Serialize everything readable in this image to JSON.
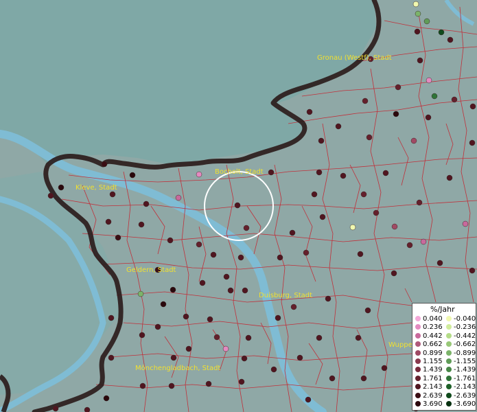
{
  "map": {
    "colors": {
      "water": "#7fbcd4",
      "land": "#8fa8a6",
      "border": "#2a1a1a",
      "district_lines": "#c0303a",
      "label": "#f0e030"
    },
    "cities": [
      {
        "name": "Gronau (Westf), Stadt"
      },
      {
        "name": "Bocholt, Stadt"
      },
      {
        "name": "Kleve, Stadt"
      },
      {
        "name": "Geldern, Stadt"
      },
      {
        "name": "Duisburg, Stadt"
      },
      {
        "name": "Wuppe"
      },
      {
        "name": "Mönchengladbach, Stadt"
      }
    ]
  },
  "legend": {
    "title": "%/Jahr",
    "pos_values": [
      "0.040",
      "0.236",
      "0.442",
      "0.662",
      "0.899",
      "1.155",
      "1.439",
      "1.761",
      "2.143",
      "2.639",
      "3.690"
    ],
    "neg_values": [
      "-0.040",
      "-0.236",
      "-0.442",
      "-0.662",
      "-0.899",
      "-1.155",
      "-1.439",
      "-1.761",
      "-2.143",
      "-2.639",
      "-3.690"
    ],
    "pos_colors": [
      "#f4a8d8",
      "#e48ac0",
      "#c86a9c",
      "#b05a7c",
      "#a04a64",
      "#8a3a4e",
      "#782a3c",
      "#64202c",
      "#501620",
      "#3a0e14",
      "#2a080c"
    ],
    "neg_colors": [
      "#f0f8b0",
      "#d0ec9c",
      "#b4dc88",
      "#98c878",
      "#7cb46a",
      "#609c58",
      "#488848",
      "#307438",
      "#1e6028",
      "#104a1c",
      "#063010"
    ]
  }
}
